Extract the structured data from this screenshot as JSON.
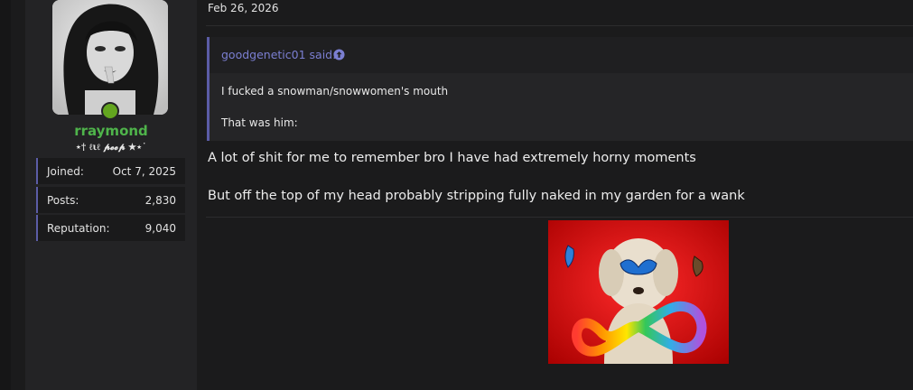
{
  "post": {
    "date": "Feb 26, 2026",
    "quote": {
      "author_label": "goodgenetic01 said:",
      "lines": [
        "I fucked a snowman/snowwomen's mouth",
        "That was him:"
      ]
    },
    "message": [
      "A lot of shit for me to remember bro I have had extremely horny moments",
      "But off the top of my head probably stripping fully naked in my garden for a wank"
    ]
  },
  "author": {
    "username": "rraymond",
    "title": "⋆† ℓιℓ 𝓹𝓮𝓮𝓹 ★⋆˙",
    "online": true,
    "stats": [
      {
        "label": "Joined:",
        "value": "Oct 7, 2025"
      },
      {
        "label": "Posts:",
        "value": "2,830"
      },
      {
        "label": "Reputation:",
        "value": "9,040"
      }
    ]
  },
  "colors": {
    "username": "#4fb44b",
    "accent": "#5b5ca6",
    "quote_author": "#7b7fd2",
    "online_dot": "#63a51f"
  },
  "icons": [
    "arrow-up-circle-icon"
  ]
}
